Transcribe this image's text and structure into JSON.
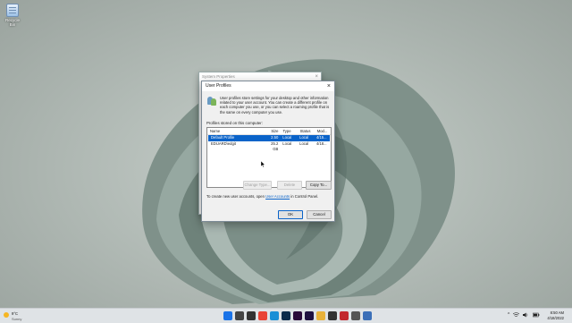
{
  "desktop": {
    "recycle_bin_label": "Recycle Bin"
  },
  "system_properties": {
    "title": "System Properties"
  },
  "dialog": {
    "title": "User Profiles",
    "intro": "User profiles store settings for your desktop and other information related to your user account. You can create a different profile on each computer you use, or you can select a roaming profile that is the same on every computer you use.",
    "profiles_label": "Profiles stored on this computer:",
    "columns": [
      "Name",
      "Size",
      "Type",
      "Status",
      "Mod..."
    ],
    "rows": [
      {
        "name": "Default Profile",
        "size": "2.50 MB",
        "type": "Local",
        "status": "Local",
        "modified": "4/15..."
      },
      {
        "name": "EDUARD\\edgit",
        "size": "25.2 GB",
        "type": "Local",
        "status": "Local",
        "modified": "4/18..."
      }
    ],
    "change_type_label": "Change Type...",
    "delete_label": "Delete",
    "copy_to_label": "Copy To...",
    "accounts_text_before": "To create new user accounts, open",
    "accounts_link": "User Accounts",
    "accounts_text_after": "in Control Panel.",
    "ok_label": "OK",
    "cancel_label": "Cancel",
    "close_glyph": "×"
  },
  "taskbar": {
    "weather_temp": "9°C",
    "weather_desc": "Sunny",
    "icons": [
      "start-icon",
      "search-icon",
      "task-view-icon",
      "chrome-icon",
      "edge-icon",
      "photoshop-icon",
      "premiere-icon",
      "after-effects-icon",
      "explorer-icon",
      "camera-icon",
      "app-icon",
      "settings-icon",
      "control-panel-icon"
    ],
    "icon_colors": [
      "#1a73e8",
      "#444",
      "#333",
      "#e94335",
      "#1b8fd6",
      "#0b2b4a",
      "#2a0a3a",
      "#1f1140",
      "#e9b23a",
      "#333",
      "#c2282e",
      "#555",
      "#3b6fb8"
    ],
    "tray_chevron": "^",
    "clock_time": "8:50 AM",
    "clock_date": "4/18/2022"
  }
}
